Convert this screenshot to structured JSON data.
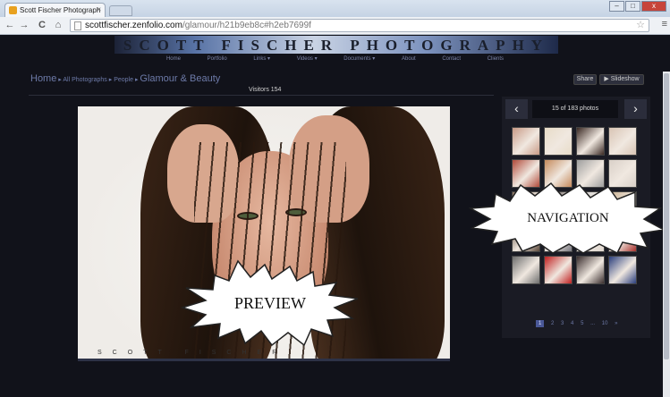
{
  "browser": {
    "tab_title": "Scott Fischer Photograph",
    "tab_close": "×",
    "address_host": "scottfischer.zenfolio.com",
    "address_path": "/glamour/h21b9eb8c#h2eb7699f",
    "back": "←",
    "forward": "→",
    "reload": "C",
    "home": "⌂",
    "star": "☆",
    "menu": "≡",
    "win_min": "–",
    "win_max": "□",
    "win_close": "x"
  },
  "site": {
    "title": "SCOTT FISCHER PHOTOGRAPHY",
    "nav": [
      "Home",
      "Portfolio",
      "Links ▾",
      "Videos ▾",
      "Documents ▾",
      "About",
      "Contact",
      "Clients"
    ],
    "breadcrumb": {
      "home": "Home",
      "sep1": " ▸ ",
      "all": "All Photographs",
      "sep2": " ▸ ",
      "people": "People",
      "sep3": " ▸ ",
      "current": "Glamour & Beauty"
    },
    "share": "Share",
    "slideshow": "▶ Slideshow",
    "visitors": "Visitors 154",
    "watermark": "SCOTT FISCHER"
  },
  "panel": {
    "prev": "‹",
    "next": "›",
    "count": "15 of 183 photos",
    "thumb_colors": [
      "#c89a86",
      "#e8dcc8",
      "#3b2a24",
      "#d8c4b4",
      "#b14a3a",
      "#c58a5c",
      "#9e9e9e",
      "#d9d0c8",
      "#8a7260",
      "#2a2226",
      "#cfcfcf",
      "#c8b090",
      "#5d4a3c",
      "#7a7a82",
      "#e0d8d0",
      "#a8302c",
      "#6d6d6d",
      "#c02020",
      "#3a2e2e",
      "#2a3e7c"
    ],
    "pager": [
      "1",
      "2",
      "3",
      "4",
      "5",
      "...",
      "10",
      "»"
    ]
  },
  "callouts": {
    "navigation": "NAVIGATION",
    "preview": "PREVIEW"
  }
}
